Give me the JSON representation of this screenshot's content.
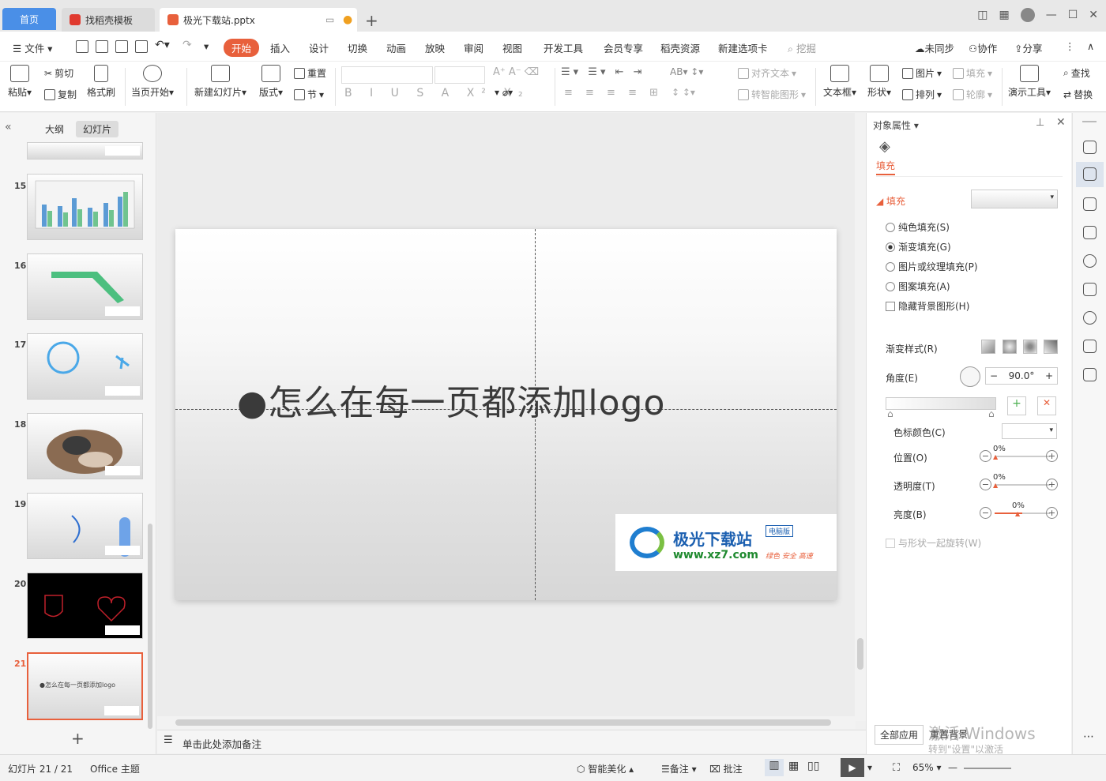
{
  "tabs": {
    "home": "首页",
    "template": "找稻壳模板",
    "document": "极光下载站.pptx"
  },
  "menu": {
    "file": "文件",
    "items": [
      "开始",
      "插入",
      "设计",
      "切换",
      "动画",
      "放映",
      "审阅",
      "视图",
      "开发工具",
      "会员专享",
      "稻壳资源",
      "新建选项卡"
    ],
    "search": "挖掘",
    "unsync": "未同步",
    "collab": "协作",
    "share": "分享"
  },
  "ribbon": {
    "paste": "粘贴",
    "cut": "剪切",
    "copy": "复制",
    "format_painter": "格式刷",
    "from_current": "当页开始",
    "new_slide": "新建幻灯片",
    "layout": "版式",
    "reset": "重置",
    "section": "节",
    "align_text": "对齐文本",
    "smart_shape": "转智能图形",
    "textbox": "文本框",
    "shape": "形状",
    "picture": "图片",
    "fill": "填充",
    "arrange": "排列",
    "outline": "轮廓",
    "present_tools": "演示工具",
    "find": "查找",
    "replace": "替换"
  },
  "left_panel": {
    "outline_tab": "大纲",
    "slides_tab": "幻灯片",
    "slides": [
      {
        "num": "15",
        "kind": "chart"
      },
      {
        "num": "16",
        "kind": "arrow"
      },
      {
        "num": "17",
        "kind": "circle"
      },
      {
        "num": "18",
        "kind": "photo"
      },
      {
        "num": "19",
        "kind": "arcs"
      },
      {
        "num": "20",
        "kind": "dark"
      },
      {
        "num": "21",
        "kind": "text",
        "text": "●怎么在每一页都添加logo"
      }
    ]
  },
  "slide": {
    "text": "●怎么在每一页都添加logo",
    "logo_cn": "极光下载站",
    "logo_url": "www.xz7.com",
    "logo_badge": "电脑版",
    "logo_sub": "绿色 安全 高速"
  },
  "notes_placeholder": "单击此处添加备注",
  "properties": {
    "title": "对象属性",
    "tab_fill": "填充",
    "section_fill": "填充",
    "options": [
      "纯色填充(S)",
      "渐变填充(G)",
      "图片或纹理填充(P)",
      "图案填充(A)"
    ],
    "selected_option": "渐变填充(G)",
    "hide_bg": "隐藏背景图形(H)",
    "gradient_style": "渐变样式(R)",
    "angle_label": "角度(E)",
    "angle_value": "90.0°",
    "stop_color": "色标颜色(C)",
    "position": "位置(O)",
    "position_value": "0%",
    "transparency": "透明度(T)",
    "transparency_value": "0%",
    "brightness": "亮度(B)",
    "brightness_value": "0%",
    "rotate_with_shape": "与形状一起旋转(W)",
    "apply_all": "全部应用",
    "reset_bg": "重置背景"
  },
  "status": {
    "slide_count": "幻灯片 21 / 21",
    "theme": "Office 主题",
    "smart_beautify": "智能美化",
    "notes": "备注",
    "comments": "批注",
    "zoom": "65%"
  },
  "watermark": {
    "line1": "激活 Windows",
    "line2": "转到\"设置\"以激活"
  },
  "colors": {
    "accent": "#e8603c",
    "home_tab": "#4a8fe7"
  }
}
